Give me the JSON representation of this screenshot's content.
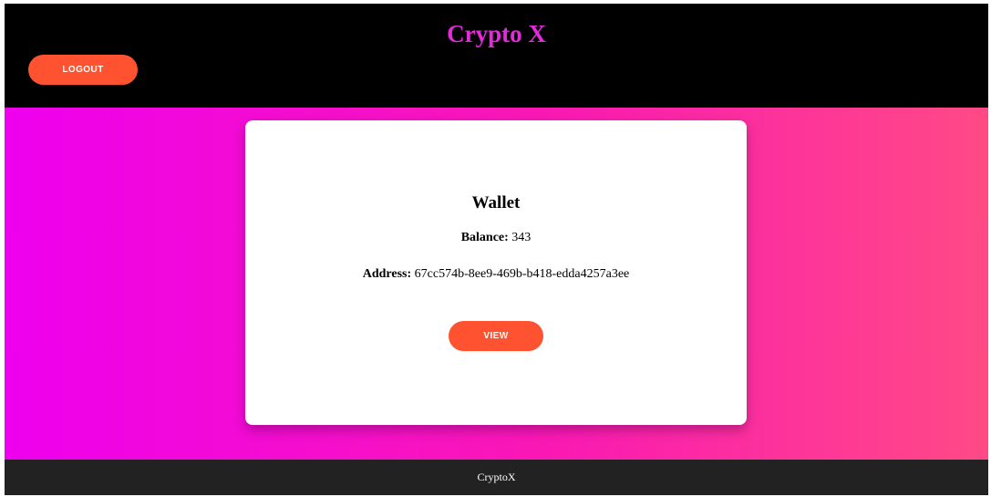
{
  "header": {
    "title": "Crypto X",
    "logout_label": "LOGOUT"
  },
  "wallet": {
    "title": "Wallet",
    "balance_label": "Balance:",
    "balance_value": "343",
    "address_label": "Address:",
    "address_value": "67cc574b-8ee9-469b-b418-edda4257a3ee",
    "view_label": "VIEW"
  },
  "footer": {
    "text": "CryptoX"
  },
  "colors": {
    "header_bg": "#000000",
    "title": "#e22bd9",
    "button": "#ff5231",
    "gradient_start": "#ee00ee",
    "gradient_end": "#ff4a85",
    "footer_bg": "#222222"
  }
}
